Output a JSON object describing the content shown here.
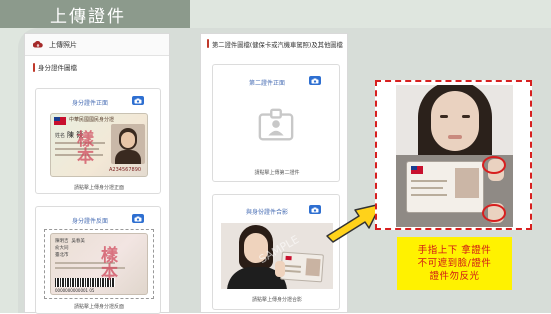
{
  "banner": {
    "title": "上傳證件"
  },
  "left_panel": {
    "header": "上傳照片",
    "section": "身分證件圖檔",
    "front_card": {
      "title": "身分證件正面",
      "hint": "請點擊上傳身分證正面",
      "watermark": "樣本",
      "card_header": "中華民國國民身分證",
      "name_label": "姓名",
      "name": "陳 筱",
      "id_number": "A234567890"
    },
    "back_card": {
      "title": "身分證件反面",
      "hint": "請點擊上傳身分證反面",
      "watermark": "樣本",
      "father": "陳明吉",
      "mother": "吳春美",
      "spouse": "俞大同",
      "birthplace": "臺北市",
      "barcode_number": "0000000000001 05"
    }
  },
  "mid_panel": {
    "section": "第二證件圖檔(健保卡或汽機車駕照)及其他圖檔",
    "second_card": {
      "title": "第二證件正面",
      "hint": "請點擊上傳第二證件"
    },
    "selfie_card": {
      "title": "與身份證件合影",
      "hint": "請點擊上傳身分證合影",
      "watermark": "SAMPLE"
    }
  },
  "note": {
    "lines": [
      "手指上下 拿證件",
      "不可遮到臉/證件",
      "證件勿反光"
    ]
  },
  "colors": {
    "accent_blue": "#2e6fd1",
    "title_blue": "#4a6fb5",
    "red": "#d71f1f",
    "note_bg": "#fff200",
    "banner": "#8c9a8c"
  }
}
